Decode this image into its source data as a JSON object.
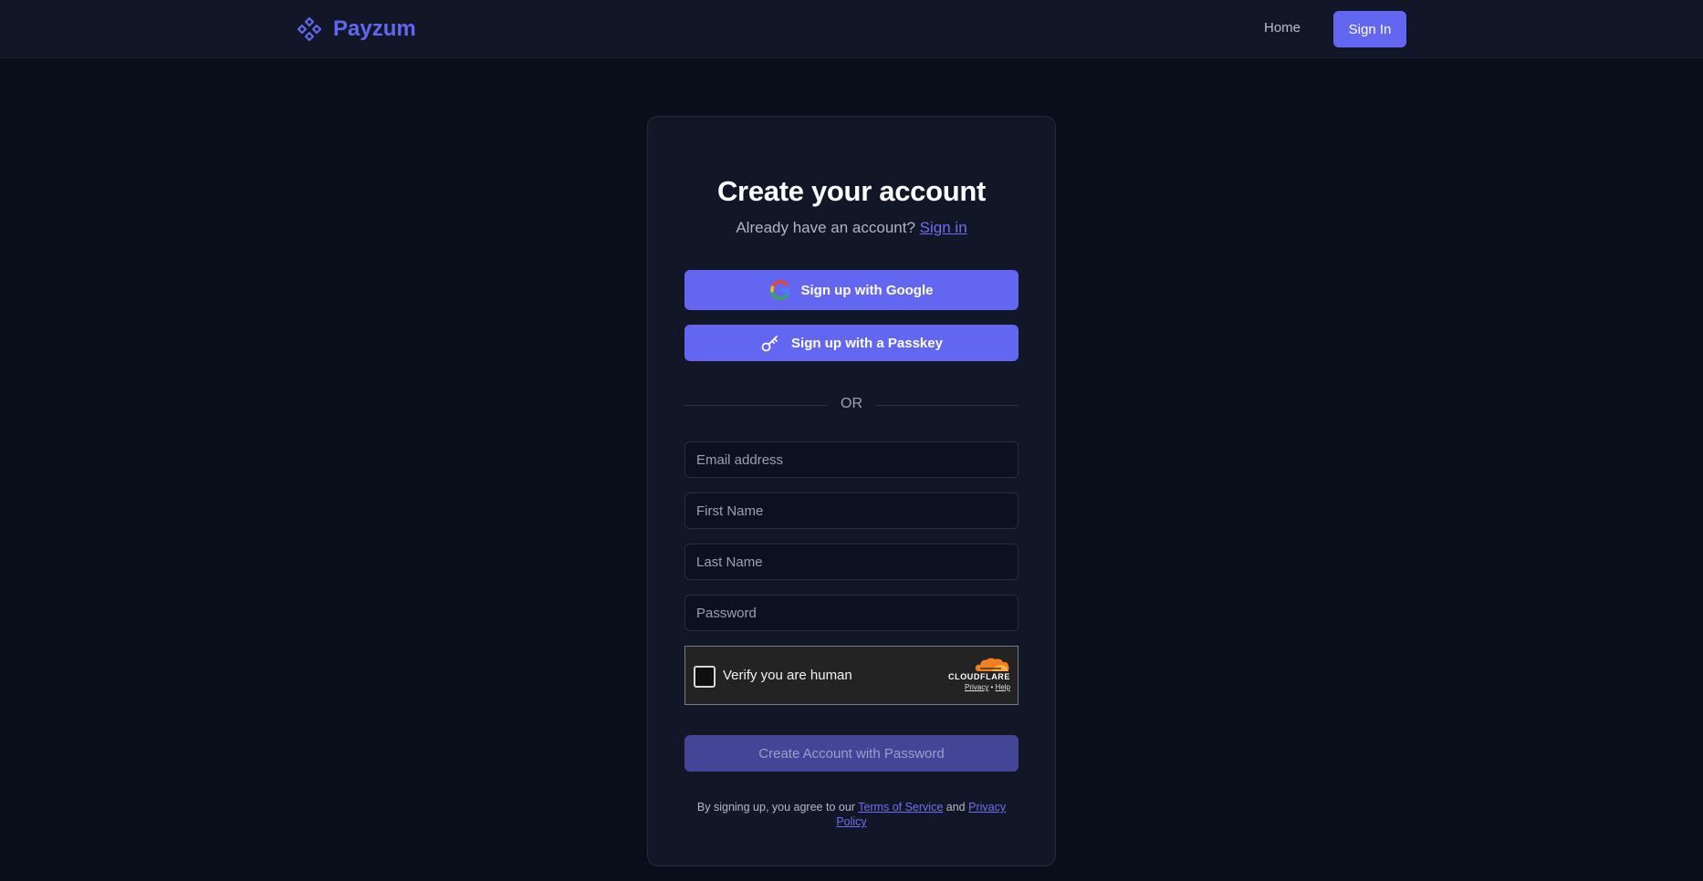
{
  "header": {
    "brand_name": "Payzum",
    "brand_icon": "diamond-grid-icon",
    "home_label": "Home",
    "signin_label": "Sign In"
  },
  "signup": {
    "title": "Create your account",
    "subtitle_prefix": "Already have an account?",
    "signin_link": "Sign in",
    "google_label": "Sign up with Google",
    "passkey_label": "Sign up with a Passkey",
    "divider_text": "OR",
    "email_placeholder": "Email address",
    "first_name_placeholder": "First Name",
    "last_name_placeholder": "Last Name",
    "password_placeholder": "Password",
    "captcha": {
      "label": "Verify you are human",
      "brand": "CLOUDFLARE",
      "privacy": "Privacy",
      "separator": "•",
      "help": "Help"
    },
    "create_label": "Create Account with Password",
    "terms_prefix": "By signing up, you agree to our",
    "terms_link": "Terms of Service",
    "terms_and": "and",
    "privacy_link": "Privacy Policy"
  },
  "colors": {
    "accent": "#6366f1",
    "background": "#0a0e1a",
    "card": "#121728",
    "disabled_button": "#444596"
  }
}
